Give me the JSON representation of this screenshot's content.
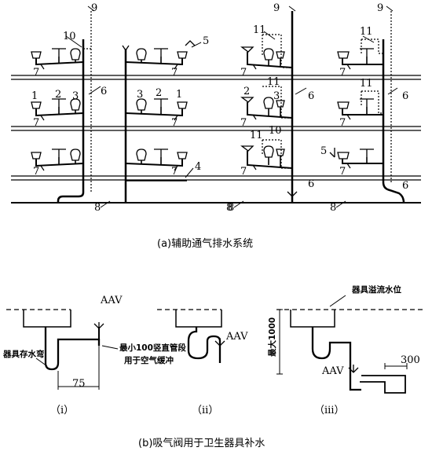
{
  "caption_a": "(a)辅助通气排水系统",
  "caption_b": "(b)吸气阀用于卫生器具补水",
  "sub_i": "（ⅰ）",
  "sub_ii": "（ⅱ）",
  "sub_iii": "（ⅲ）",
  "n1": "1",
  "n2": "2",
  "n3": "3",
  "n4": "4",
  "n5": "5",
  "n6": "6",
  "n7": "7",
  "n8": "8",
  "n9": "9",
  "n10": "10",
  "n11": "11",
  "aav": "AAV",
  "trap_label": "器具存水弯",
  "min_label_1": "最小100竖直管段",
  "min_label_2": "用于空气缓冲",
  "dim_75": "75",
  "max_label": "最大1000",
  "overflow_label": "器具溢流水位",
  "dim_300": "300"
}
